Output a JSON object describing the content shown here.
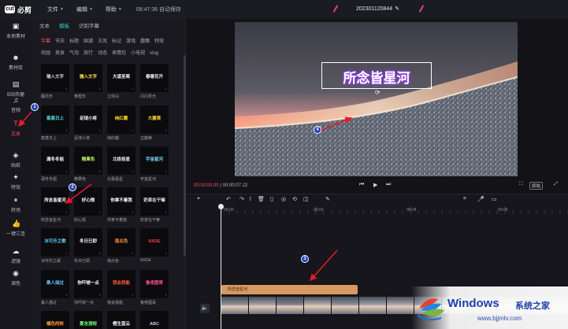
{
  "app": {
    "logo_mark": "cut",
    "logo_text": "必剪",
    "menus": [
      {
        "label": "文件"
      },
      {
        "label": "编辑"
      },
      {
        "label": "帮助"
      }
    ],
    "autosave": "08:47:36 自动保存",
    "project_title": "202301120844",
    "project_edit_icon": "✎"
  },
  "leftbar": [
    {
      "label": "本地素材",
      "icon": "folder-icon",
      "glyph": "▣"
    },
    {
      "label": "素材库",
      "icon": "skull-icon",
      "glyph": "☻"
    },
    {
      "label": "B站热梗",
      "icon": "tv-icon",
      "glyph": "▤"
    },
    {
      "label": "音频",
      "icon": "music-icon",
      "glyph": "♫"
    },
    {
      "label": "文本",
      "icon": "text-icon",
      "glyph": "T",
      "active": true
    },
    {
      "label": "贴纸",
      "icon": "sticker-icon",
      "glyph": "◈"
    },
    {
      "label": "特效",
      "icon": "sparkle-icon",
      "glyph": "✦"
    },
    {
      "label": "转场",
      "icon": "transition-icon",
      "glyph": "⏸"
    },
    {
      "label": "一键三连",
      "icon": "thumb-up-icon",
      "glyph": "👍"
    },
    {
      "label": "滤镜",
      "icon": "filter-icon",
      "glyph": "☁"
    },
    {
      "label": "调色",
      "icon": "palette-icon",
      "glyph": "◉"
    }
  ],
  "panel": {
    "tabs": [
      {
        "label": "文本"
      },
      {
        "label": "模板",
        "active": true
      },
      {
        "label": "识别字幕"
      }
    ],
    "category_rows": [
      [
        "字幕",
        "节庆",
        "标题",
        "国潮",
        "古风",
        "标记",
        "游戏",
        "趣舞",
        "特效"
      ],
      [
        "校园",
        "美食",
        "气泡",
        "旅行",
        "动态",
        "表情包",
        "小电视",
        "vlog"
      ]
    ],
    "tiles": [
      {
        "label": "翻页形",
        "art": "输入文字",
        "color": "#d8d8d8"
      },
      {
        "label": "黄框形",
        "art": "输入文字",
        "color": "#ffe23d"
      },
      {
        "label": "立体白",
        "art": "大道至简",
        "color": "#ffffff"
      },
      {
        "label": "闪闪发光",
        "art": "春暖花开",
        "color": "#f3f3f3"
      },
      {
        "label": "蒸蒸日上",
        "art": "蒸蒸日上",
        "color": "#5ee0e8"
      },
      {
        "label": "足球小将",
        "art": "足球小将",
        "color": "#ffffff"
      },
      {
        "label": "纯红霸",
        "art": "纯红霸",
        "color": "#ffd21f"
      },
      {
        "label": "古藤黄",
        "art": "大藤黄",
        "color": "#ffd93a"
      },
      {
        "label": "潇冬冬姐",
        "art": "潇冬冬姐",
        "color": "#ffffff"
      },
      {
        "label": "精果色",
        "art": "精果色",
        "color": "#c8ff5e"
      },
      {
        "label": "北极极星",
        "art": "北极极星",
        "color": "#e8e8e8"
      },
      {
        "label": "宇宙星河",
        "art": "宇宙星河",
        "color": "#7fd4ff"
      },
      {
        "label": "所念皆星河",
        "art": "所念皆星河",
        "color": "#ffffff"
      },
      {
        "label": "好心情",
        "art": "好心情",
        "color": "#ffffff"
      },
      {
        "label": "你拿不着我",
        "art": "你拿不着我",
        "color": "#ffffff"
      },
      {
        "label": "奶茶在干嘛",
        "art": "奶茶在干嘛",
        "color": "#e8e8e8"
      },
      {
        "label": "冰可乐之歌",
        "art": "冰可乐之歌",
        "color": "#5ec8ff"
      },
      {
        "label": "冬日已即",
        "art": "冬日已即",
        "color": "#ffffff"
      },
      {
        "label": "南瓜色",
        "art": "南瓜色",
        "color": "#ff8c3a"
      },
      {
        "label": "NXDE",
        "art": "NXDE",
        "color": "#ff3a3a"
      },
      {
        "label": "桑人描过",
        "art": "桑人描过",
        "color": "#5ec8ff"
      },
      {
        "label": "你吓唬一点",
        "art": "你吓唬一点",
        "color": "#ffffff"
      },
      {
        "label": "我会我能",
        "art": "我会我能",
        "color": "#ff5a3a"
      },
      {
        "label": "鲁佬图哥",
        "art": "鲁佬图哥",
        "color": "#ff4d8c"
      },
      {
        "label": "",
        "art": "橘色的秋",
        "color": "#ff9f3a"
      },
      {
        "label": "",
        "art": "夏含酒柑",
        "color": "#7fff7f"
      },
      {
        "label": "",
        "art": "橙生蓝云",
        "color": "#ffffff"
      },
      {
        "label": "",
        "art": "ABC",
        "color": "#c8c8ff"
      }
    ]
  },
  "preview": {
    "caption": "所念皆星河",
    "current_time": "00:00:00.00",
    "total_time": "00:00:07.22",
    "ratio_button": "原始",
    "prev_icon": "⏮",
    "play_icon": "▶",
    "next_icon": "⏭"
  },
  "timeline": {
    "ruler_labels": [
      "00:00",
      "00:02",
      "00:04",
      "00:06"
    ],
    "text_clip_label": "所念皆星河",
    "tools": [
      {
        "name": "select-tool-icon",
        "glyph": "⌖"
      },
      {
        "name": "undo-icon",
        "glyph": "↶"
      },
      {
        "name": "redo-icon",
        "glyph": "↷"
      },
      {
        "name": "split-icon",
        "glyph": "⌇"
      },
      {
        "name": "delete-icon",
        "glyph": "🗑"
      },
      {
        "name": "crop-icon",
        "glyph": "▯"
      },
      {
        "name": "freeze-icon",
        "glyph": "◎"
      },
      {
        "name": "reverse-icon",
        "glyph": "⟲"
      },
      {
        "name": "mirror-icon",
        "glyph": "◫"
      },
      {
        "name": "marker-icon",
        "glyph": "✎"
      }
    ],
    "mute_icon": "🔈"
  },
  "annotations": [
    "1",
    "2",
    "3",
    "4"
  ],
  "watermark": {
    "title": "Windows",
    "suffix": "系统之家",
    "url": "www.bjjmlv.com"
  }
}
